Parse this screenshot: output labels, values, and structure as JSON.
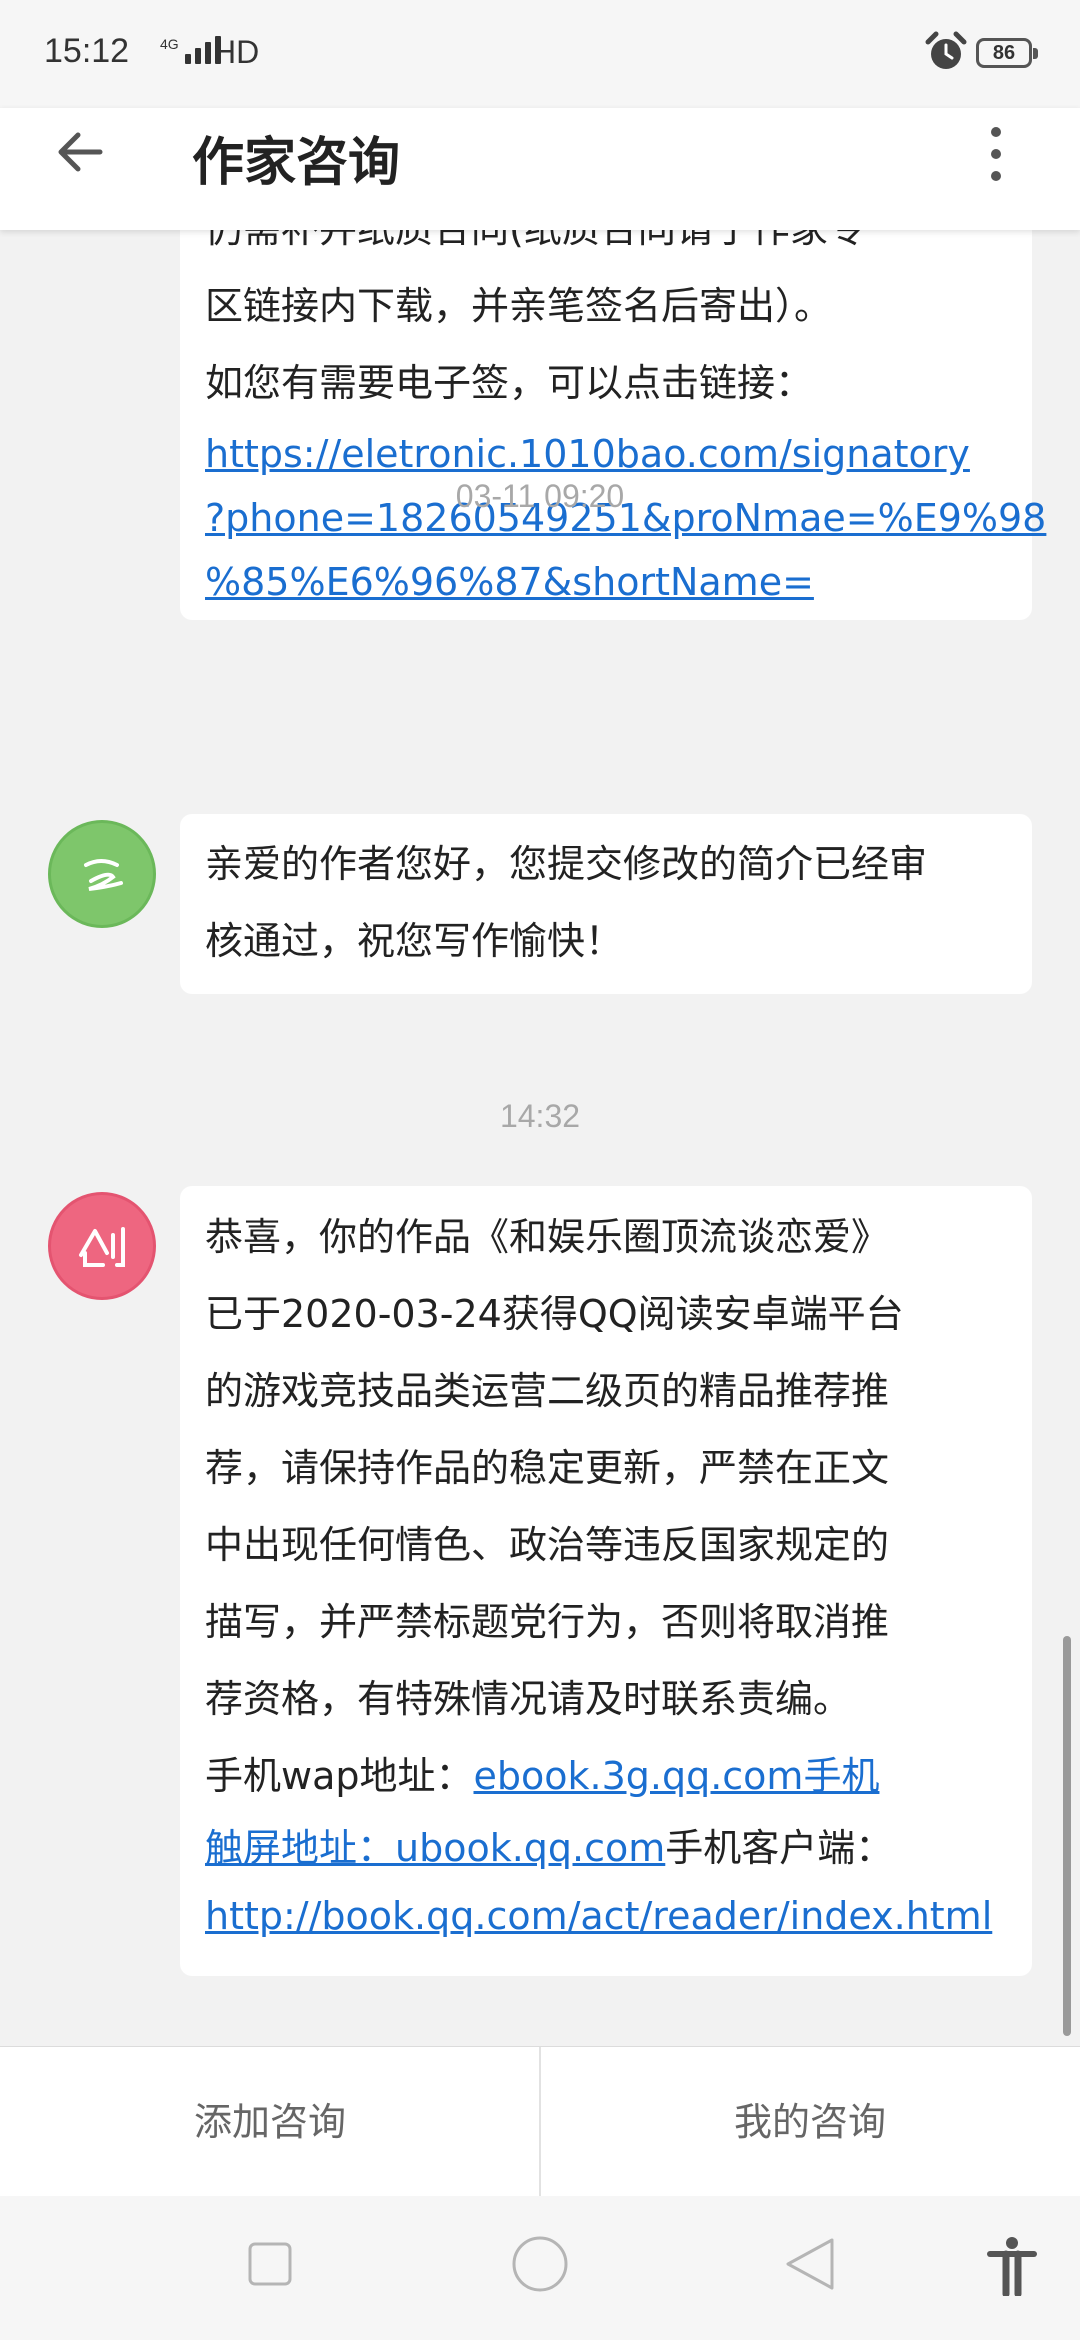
{
  "status_bar": {
    "time": "15:12",
    "network": "4G",
    "hd": "HD",
    "battery": "86",
    "alarm_icon": "alarm-clock-icon"
  },
  "header": {
    "title": "作家咨询",
    "back_icon": "arrow-left-icon",
    "more_icon": "more-vertical-icon"
  },
  "messages": [
    {
      "lines": [
        "仍需补并纸质合同(纸质合同请于作家专",
        "区链接内下载，并亲笔签名后寄出）。",
        "如您有需要电子签，可以点击链接：",
        "https://eletronic.1010bao.com/signatory",
        "?phone=18260549251&proNmae=%E9%98",
        "%85%E6%96%87&shortName="
      ]
    },
    {
      "timestamp": "03-11 09:20",
      "avatar": "green-avatar",
      "lines": [
        "亲爱的作者您好，您提交修改的简介已经审",
        "核通过，祝您写作愉快！"
      ]
    },
    {
      "timestamp": "14:32",
      "avatar": "pink-avatar",
      "lines": [
        "恭喜，你的作品《和娱乐圈顶流谈恋爱》",
        "已于2020-03-24获得QQ阅读安卓端平台",
        "的游戏竞技品类运营二级页的精品推荐推",
        "荐，请保持作品的稳定更新，严禁在正文",
        "中出现任何情色、政治等违反国家规定的",
        "描写，并严禁标题党行为，否则将取消推",
        "荐资格，有特殊情况请及时联系责编。"
      ],
      "wap_label": "手机wap地址：",
      "wap_link": "ebook.3g.qq.com手机",
      "touch_link": "触屏地址：ubook.qq.com",
      "client_label": "手机客户端：",
      "client_link": "http://book.qq.com/act/reader/index.html"
    }
  ],
  "bottom_tabs": {
    "add": "添加咨询",
    "mine": "我的咨询"
  },
  "nav_bar": [
    "square-recent-icon",
    "circle-home-icon",
    "triangle-back-icon",
    "accessibility-icon"
  ]
}
